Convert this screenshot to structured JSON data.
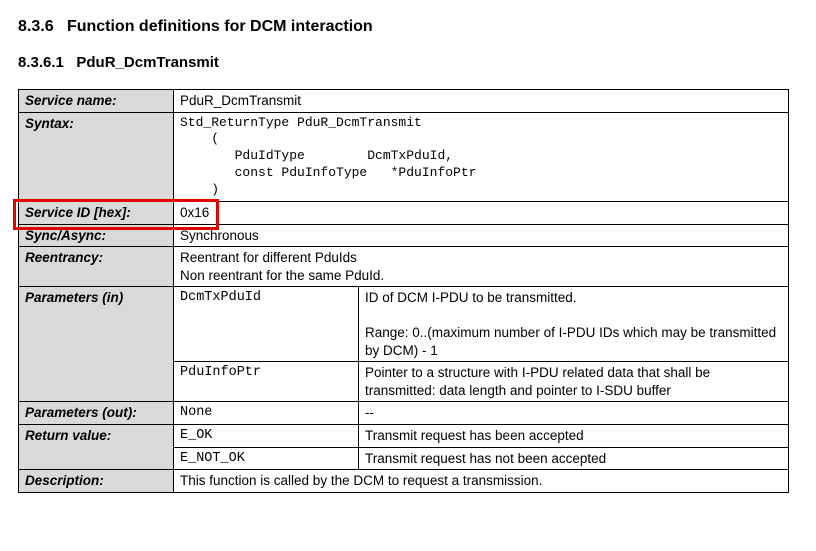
{
  "heading": {
    "num": "8.3.6",
    "text": "Function definitions for DCM interaction"
  },
  "subheading": {
    "num": "8.3.6.1",
    "text": "PduR_DcmTransmit"
  },
  "rows": {
    "service_name": {
      "label": "Service name:",
      "value": "PduR_DcmTransmit"
    },
    "syntax": {
      "label": "Syntax:",
      "code": "Std_ReturnType PduR_DcmTransmit\n    (\n       PduIdType        DcmTxPduId,\n       const PduInfoType   *PduInfoPtr\n    )"
    },
    "service_id": {
      "label": "Service ID [hex]:",
      "value": "0x16"
    },
    "sync_async": {
      "label": "Sync/Async:",
      "value": "Synchronous"
    },
    "reentrancy": {
      "label": "Reentrancy:",
      "value": "Reentrant for different PduIds\nNon reentrant for the same PduId."
    },
    "params_in": {
      "label": "Parameters (in)",
      "items": [
        {
          "name": "DcmTxPduId",
          "desc": "ID of DCM I-PDU to be transmitted.\n\nRange: 0..(maximum number of I-PDU IDs which may be transmitted by DCM) - 1"
        },
        {
          "name": "PduInfoPtr",
          "desc": "Pointer to a structure with I-PDU related data that shall be transmitted: data length and pointer to I-SDU buffer"
        }
      ]
    },
    "params_out": {
      "label": "Parameters (out):",
      "name": "None",
      "desc": "--"
    },
    "return_value": {
      "label": "Return value:",
      "items": [
        {
          "name": "E_OK",
          "desc": "Transmit request has been accepted"
        },
        {
          "name": "E_NOT_OK",
          "desc": "Transmit request has not been accepted"
        }
      ]
    },
    "description": {
      "label": "Description:",
      "value": "This function is called by the DCM to request a transmission."
    }
  }
}
